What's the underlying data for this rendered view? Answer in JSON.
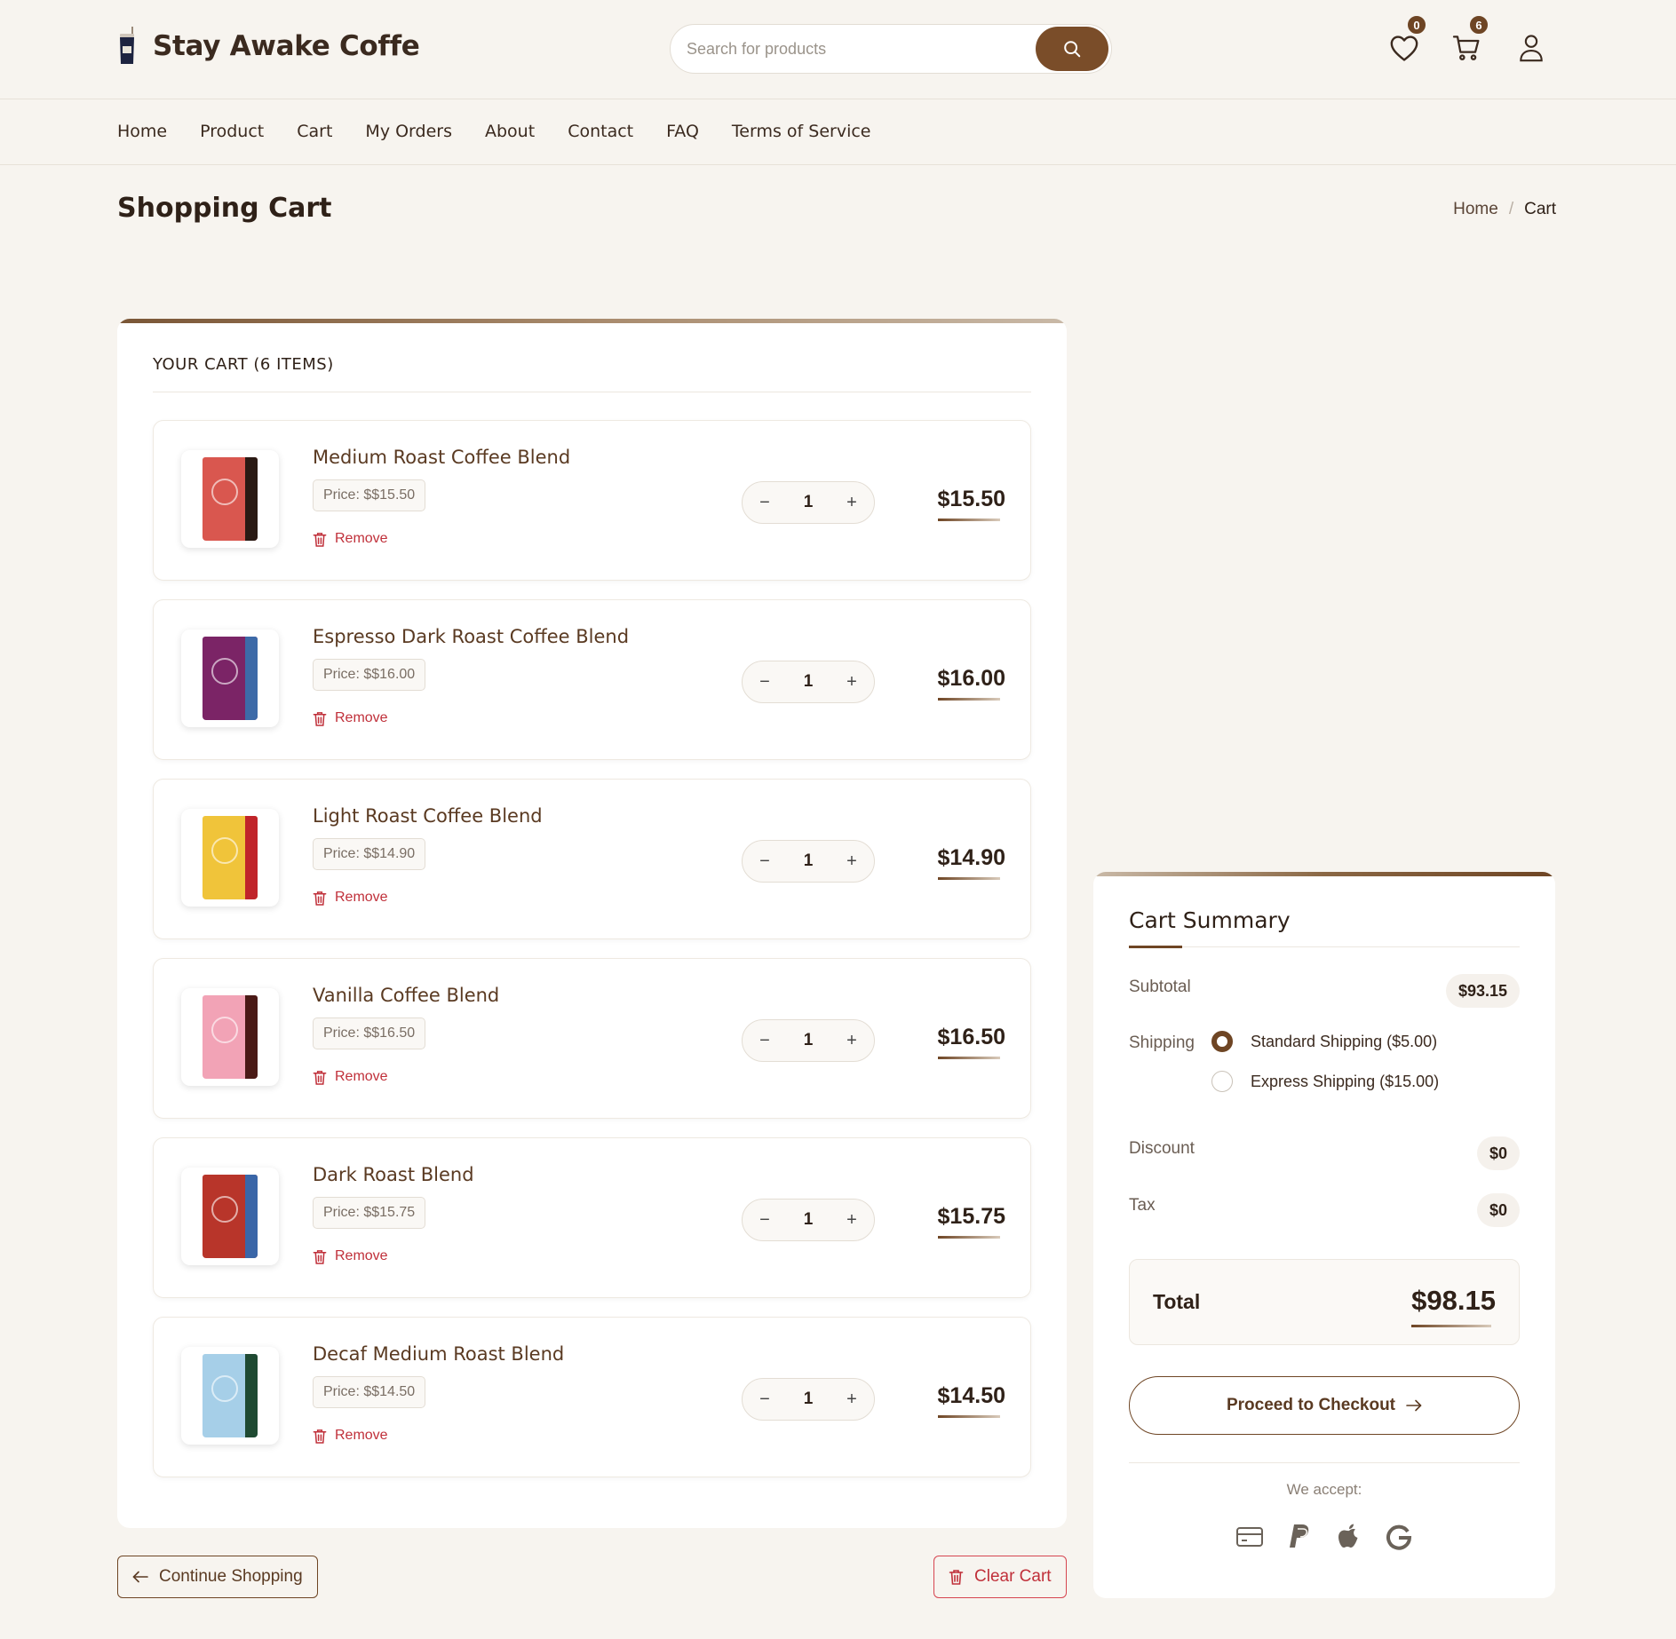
{
  "header": {
    "brand": "Stay Awake Coffe",
    "search_placeholder": "Search for products",
    "wishlist_count": "0",
    "cart_count": "6"
  },
  "nav": [
    "Home",
    "Product",
    "Cart",
    "My Orders",
    "About",
    "Contact",
    "FAQ",
    "Terms of Service"
  ],
  "page": {
    "title": "Shopping Cart",
    "breadcrumb": {
      "home": "Home",
      "sep": "/",
      "current": "Cart"
    }
  },
  "cart": {
    "heading": "YOUR CART (6 ITEMS)",
    "items": [
      {
        "name": "Medium Roast Coffee Blend",
        "price": "Price: $$15.50",
        "qty": "1",
        "total": "$15.50",
        "remove": "Remove",
        "bag_color": "#d9574f",
        "side_color": "#2a1a14"
      },
      {
        "name": "Espresso Dark Roast Coffee Blend",
        "price": "Price: $$16.00",
        "qty": "1",
        "total": "$16.00",
        "remove": "Remove",
        "bag_color": "#7b2466",
        "side_color": "#3d6aa8"
      },
      {
        "name": "Light Roast Coffee Blend",
        "price": "Price: $$14.90",
        "qty": "1",
        "total": "$14.90",
        "remove": "Remove",
        "bag_color": "#f0c43a",
        "side_color": "#c0242a"
      },
      {
        "name": "Vanilla Coffee Blend",
        "price": "Price: $$16.50",
        "qty": "1",
        "total": "$16.50",
        "remove": "Remove",
        "bag_color": "#f2a3b6",
        "side_color": "#4a1a16"
      },
      {
        "name": "Dark Roast Blend",
        "price": "Price: $$15.75",
        "qty": "1",
        "total": "$15.75",
        "remove": "Remove",
        "bag_color": "#b8352a",
        "side_color": "#3a66a8"
      },
      {
        "name": "Decaf Medium Roast Blend",
        "price": "Price: $$14.50",
        "qty": "1",
        "total": "$14.50",
        "remove": "Remove",
        "bag_color": "#a6cfe8",
        "side_color": "#1f4a32"
      }
    ],
    "continue_label": "Continue Shopping",
    "clear_label": "Clear Cart"
  },
  "summary": {
    "title": "Cart Summary",
    "subtotal_label": "Subtotal",
    "subtotal": "$93.15",
    "shipping_label": "Shipping",
    "shipping_options": [
      {
        "label": "Standard Shipping ($5.00)",
        "selected": true
      },
      {
        "label": "Express Shipping ($15.00)",
        "selected": false
      }
    ],
    "discount_label": "Discount",
    "discount": "$0",
    "tax_label": "Tax",
    "tax": "$0",
    "total_label": "Total",
    "total": "$98.15",
    "checkout_label": "Proceed to Checkout",
    "accept_label": "We accept:",
    "payment_icons": [
      "credit-card-icon",
      "paypal-icon",
      "apple-icon",
      "google-icon"
    ]
  },
  "colors": {
    "accent": "#6e4524",
    "danger": "#c0303a",
    "background": "#f7f4ef"
  }
}
